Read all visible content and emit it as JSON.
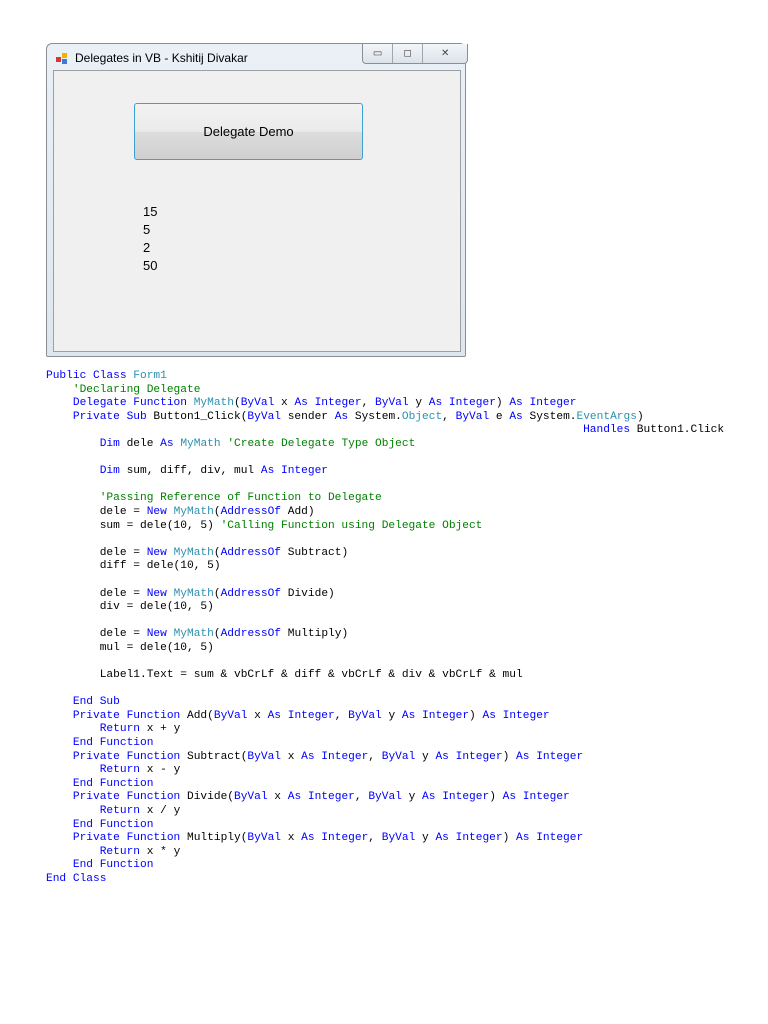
{
  "window": {
    "title": "Delegates in VB - Kshitij Divakar",
    "minimize": "▭",
    "maximize": "◻",
    "close": "✕",
    "button_label": "Delegate Demo",
    "output_lines": [
      "15",
      "5",
      "2",
      "50"
    ]
  },
  "code": [
    [
      [
        "Public Class ",
        "kw"
      ],
      [
        "Form1",
        "ty"
      ]
    ],
    [
      [
        "    'Declaring Delegate",
        "cm"
      ]
    ],
    [
      [
        "    Delegate Function ",
        "kw"
      ],
      [
        "MyMath",
        "ty"
      ],
      [
        "(",
        ""
      ],
      [
        "ByVal",
        "kw"
      ],
      [
        " x ",
        ""
      ],
      [
        "As Integer",
        "kw"
      ],
      [
        ", ",
        ""
      ],
      [
        "ByVal",
        "kw"
      ],
      [
        " y ",
        ""
      ],
      [
        "As Integer",
        "kw"
      ],
      [
        ") ",
        ""
      ],
      [
        "As Integer",
        "kw"
      ]
    ],
    [
      [
        "    Private Sub ",
        "kw"
      ],
      [
        "Button1_Click(",
        ""
      ],
      [
        "ByVal",
        "kw"
      ],
      [
        " sender ",
        ""
      ],
      [
        "As",
        "kw"
      ],
      [
        " System.",
        ""
      ],
      [
        "Object",
        "ty"
      ],
      [
        ", ",
        ""
      ],
      [
        "ByVal",
        "kw"
      ],
      [
        " e ",
        ""
      ],
      [
        "As",
        "kw"
      ],
      [
        " System.",
        ""
      ],
      [
        "EventArgs",
        "ty"
      ],
      [
        ")",
        ""
      ]
    ],
    [
      [
        "                                                                                Handles",
        "kw"
      ],
      [
        " Button1.Click",
        ""
      ]
    ],
    [
      [
        "        Dim",
        "kw"
      ],
      [
        " dele ",
        ""
      ],
      [
        "As ",
        "kw"
      ],
      [
        "MyMath ",
        "ty"
      ],
      [
        "'Create Delegate Type Object",
        "cm"
      ]
    ],
    [
      [
        "",
        ""
      ]
    ],
    [
      [
        "        Dim",
        "kw"
      ],
      [
        " sum, diff, div, mul ",
        ""
      ],
      [
        "As Integer",
        "kw"
      ]
    ],
    [
      [
        "",
        ""
      ]
    ],
    [
      [
        "        'Passing Reference of Function to Delegate",
        "cm"
      ]
    ],
    [
      [
        "        dele = ",
        ""
      ],
      [
        "New ",
        "kw"
      ],
      [
        "MyMath",
        "ty"
      ],
      [
        "(",
        ""
      ],
      [
        "AddressOf",
        "kw"
      ],
      [
        " Add)",
        ""
      ]
    ],
    [
      [
        "        sum = dele(10, 5) ",
        ""
      ],
      [
        "'Calling Function using Delegate Object",
        "cm"
      ]
    ],
    [
      [
        "",
        ""
      ]
    ],
    [
      [
        "        dele = ",
        ""
      ],
      [
        "New ",
        "kw"
      ],
      [
        "MyMath",
        "ty"
      ],
      [
        "(",
        ""
      ],
      [
        "AddressOf",
        "kw"
      ],
      [
        " Subtract)",
        ""
      ]
    ],
    [
      [
        "        diff = dele(10, 5)",
        ""
      ]
    ],
    [
      [
        "",
        ""
      ]
    ],
    [
      [
        "        dele = ",
        ""
      ],
      [
        "New ",
        "kw"
      ],
      [
        "MyMath",
        "ty"
      ],
      [
        "(",
        ""
      ],
      [
        "AddressOf",
        "kw"
      ],
      [
        " Divide)",
        ""
      ]
    ],
    [
      [
        "        div = dele(10, 5)",
        ""
      ]
    ],
    [
      [
        "",
        ""
      ]
    ],
    [
      [
        "        dele = ",
        ""
      ],
      [
        "New ",
        "kw"
      ],
      [
        "MyMath",
        "ty"
      ],
      [
        "(",
        ""
      ],
      [
        "AddressOf",
        "kw"
      ],
      [
        " Multiply)",
        ""
      ]
    ],
    [
      [
        "        mul = dele(10, 5)",
        ""
      ]
    ],
    [
      [
        "",
        ""
      ]
    ],
    [
      [
        "        Label1.Text = sum & vbCrLf & diff & vbCrLf & div & vbCrLf & mul",
        ""
      ]
    ],
    [
      [
        "",
        ""
      ]
    ],
    [
      [
        "    End Sub",
        "kw"
      ]
    ],
    [
      [
        "    Private Function",
        "kw"
      ],
      [
        " Add(",
        ""
      ],
      [
        "ByVal",
        "kw"
      ],
      [
        " x ",
        ""
      ],
      [
        "As Integer",
        "kw"
      ],
      [
        ", ",
        ""
      ],
      [
        "ByVal",
        "kw"
      ],
      [
        " y ",
        ""
      ],
      [
        "As Integer",
        "kw"
      ],
      [
        ") ",
        ""
      ],
      [
        "As Integer",
        "kw"
      ]
    ],
    [
      [
        "        Return",
        "kw"
      ],
      [
        " x + y",
        ""
      ]
    ],
    [
      [
        "    End Function",
        "kw"
      ]
    ],
    [
      [
        "    Private Function",
        "kw"
      ],
      [
        " Subtract(",
        ""
      ],
      [
        "ByVal",
        "kw"
      ],
      [
        " x ",
        ""
      ],
      [
        "As Integer",
        "kw"
      ],
      [
        ", ",
        ""
      ],
      [
        "ByVal",
        "kw"
      ],
      [
        " y ",
        ""
      ],
      [
        "As Integer",
        "kw"
      ],
      [
        ") ",
        ""
      ],
      [
        "As Integer",
        "kw"
      ]
    ],
    [
      [
        "        Return",
        "kw"
      ],
      [
        " x - y",
        ""
      ]
    ],
    [
      [
        "    End Function",
        "kw"
      ]
    ],
    [
      [
        "    Private Function",
        "kw"
      ],
      [
        " Divide(",
        ""
      ],
      [
        "ByVal",
        "kw"
      ],
      [
        " x ",
        ""
      ],
      [
        "As Integer",
        "kw"
      ],
      [
        ", ",
        ""
      ],
      [
        "ByVal",
        "kw"
      ],
      [
        " y ",
        ""
      ],
      [
        "As Integer",
        "kw"
      ],
      [
        ") ",
        ""
      ],
      [
        "As Integer",
        "kw"
      ]
    ],
    [
      [
        "        Return",
        "kw"
      ],
      [
        " x / y",
        ""
      ]
    ],
    [
      [
        "    End Function",
        "kw"
      ]
    ],
    [
      [
        "    Private Function",
        "kw"
      ],
      [
        " Multiply(",
        ""
      ],
      [
        "ByVal",
        "kw"
      ],
      [
        " x ",
        ""
      ],
      [
        "As Integer",
        "kw"
      ],
      [
        ", ",
        ""
      ],
      [
        "ByVal",
        "kw"
      ],
      [
        " y ",
        ""
      ],
      [
        "As Integer",
        "kw"
      ],
      [
        ") ",
        ""
      ],
      [
        "As Integer",
        "kw"
      ]
    ],
    [
      [
        "        Return",
        "kw"
      ],
      [
        " x * y",
        ""
      ]
    ],
    [
      [
        "    End Function",
        "kw"
      ]
    ],
    [
      [
        "End Class",
        "kw"
      ]
    ]
  ]
}
